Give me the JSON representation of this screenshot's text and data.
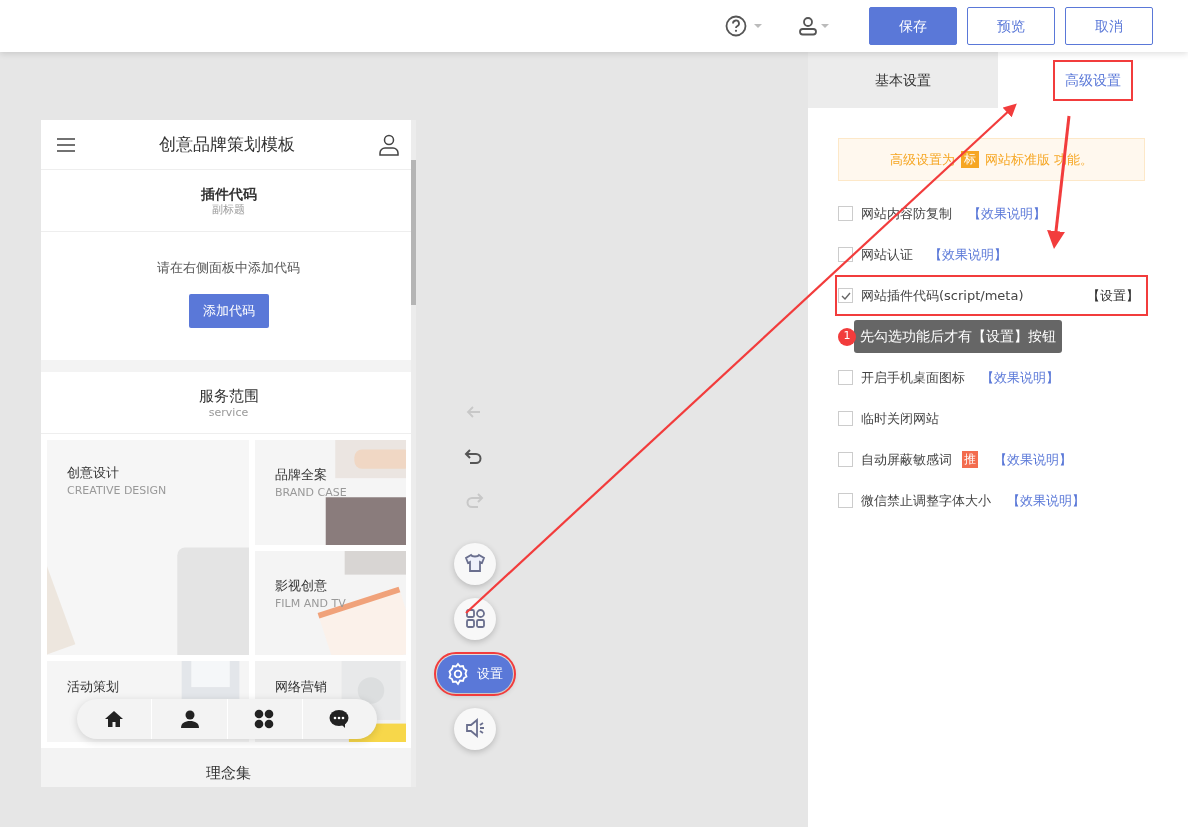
{
  "header": {
    "buttons": [
      {
        "label": "保存",
        "kind": "primary"
      },
      {
        "label": "预览",
        "kind": "outline"
      },
      {
        "label": "取消",
        "kind": "outline"
      }
    ]
  },
  "phone": {
    "title": "创意品牌策划模板",
    "plugin": {
      "title": "插件代码",
      "subtitle": "副标题",
      "hint": "请在右侧面板中添加代码",
      "button": "添加代码"
    },
    "service": {
      "title": "服务范围",
      "subtitle": "service",
      "tiles": [
        {
          "title": "创意设计",
          "subtitle": "CREATIVE DESIGN",
          "kind": "tall"
        },
        {
          "title": "品牌全案",
          "subtitle": "BRAND CASE",
          "kind": "normal"
        },
        {
          "title": "影视创意",
          "subtitle": "FILM AND TV",
          "kind": "normal"
        },
        {
          "title": "活动策划",
          "kind": "short"
        },
        {
          "title": "网络营销",
          "kind": "short"
        }
      ]
    },
    "bottom_nav": [
      {
        "kind": "home"
      },
      {
        "kind": "person"
      },
      {
        "kind": "apps"
      },
      {
        "kind": "chat"
      }
    ],
    "next_section": "理念集"
  },
  "toolbar": [
    {
      "kind": "back",
      "disabled": true
    },
    {
      "kind": "undo",
      "disabled": false
    },
    {
      "kind": "redo",
      "disabled": true
    },
    {
      "kind": "shirt",
      "selected": false,
      "highlighted": false
    },
    {
      "kind": "apps",
      "selected": false,
      "highlighted": false
    },
    {
      "kind": "settings",
      "label": "设置",
      "selected": true,
      "highlighted": true
    },
    {
      "kind": "speaker",
      "selected": false,
      "highlighted": false
    }
  ],
  "settings_panel": {
    "tabs": [
      {
        "label": "基本设置",
        "selected": false,
        "highlighted": false
      },
      {
        "label": "高级设置",
        "selected": true,
        "highlighted": true
      }
    ],
    "notice": {
      "before": "高级设置为",
      "badge": "标",
      "after": "网站标准版 功能。"
    },
    "options": [
      {
        "kind": "option",
        "label": "网站内容防复制",
        "checked": false,
        "highlighted": false,
        "link": "【效果说明】"
      },
      {
        "kind": "option",
        "label": "网站认证",
        "checked": false,
        "highlighted": false,
        "link": "【效果说明】"
      },
      {
        "kind": "option",
        "label": "网站插件代码(script/meta)",
        "checked": true,
        "highlighted": true,
        "action": "【设置】"
      },
      {
        "kind": "tooltip",
        "badge": "1",
        "text": "先勾选功能后才有【设置】按钮"
      },
      {
        "kind": "option",
        "label": "开启手机桌面图标",
        "checked": false,
        "highlighted": false,
        "link": "【效果说明】"
      },
      {
        "kind": "option",
        "label": "临时关闭网站",
        "checked": false,
        "highlighted": false
      },
      {
        "kind": "option",
        "label": "自动屏蔽敏感词",
        "checked": false,
        "highlighted": false,
        "tag": "推",
        "link": "【效果说明】"
      },
      {
        "kind": "option",
        "label": "微信禁止调整字体大小",
        "checked": false,
        "highlighted": false,
        "link": "【效果说明】"
      }
    ]
  }
}
